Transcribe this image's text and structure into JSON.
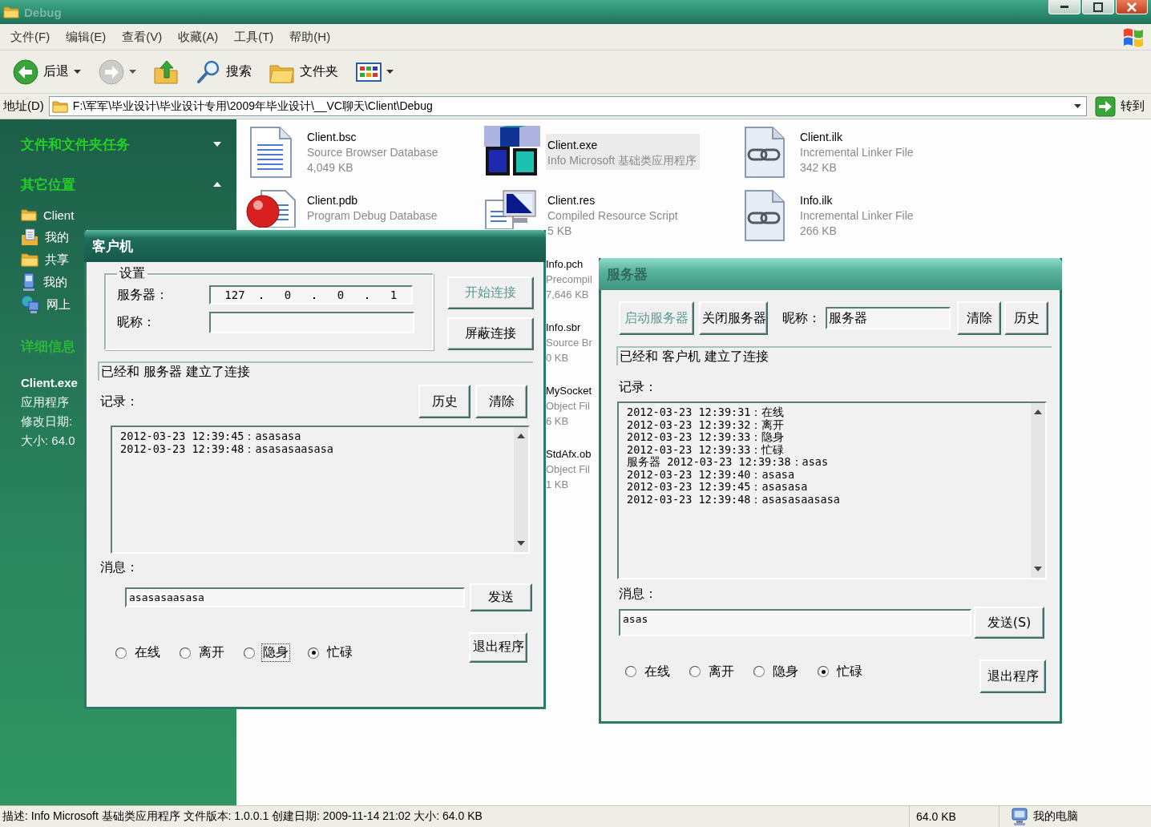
{
  "window": {
    "title": "Debug",
    "active": false
  },
  "menu": [
    "文件(F)",
    "编辑(E)",
    "查看(V)",
    "收藏(A)",
    "工具(T)",
    "帮助(H)"
  ],
  "toolbar": [
    {
      "kind": "back",
      "label": "后退",
      "disabled": false
    },
    {
      "kind": "forward",
      "disabled": true
    },
    {
      "kind": "up",
      "disabled": false
    },
    {
      "kind": "search",
      "label": "搜索",
      "disabled": false
    },
    {
      "kind": "folders",
      "label": "文件夹",
      "disabled": false
    },
    {
      "kind": "views",
      "disabled": false
    }
  ],
  "address": {
    "label": "地址(D)",
    "path": "F:\\军军\\毕业设计\\毕业设计专用\\2009年毕业设计\\__VC聊天\\Client\\Debug",
    "go": "转到"
  },
  "sidebar": {
    "sections": [
      {
        "title": "文件和文件夹任务",
        "expanded": false
      },
      {
        "title": "其它位置",
        "expanded": true,
        "items": [
          {
            "kind": "folder",
            "label": "Client"
          },
          {
            "kind": "documents",
            "label": "我的"
          },
          {
            "kind": "shared",
            "label": "共享"
          },
          {
            "kind": "computer",
            "label": "我的"
          },
          {
            "kind": "network",
            "label": "网上"
          }
        ]
      },
      {
        "title": "详细信息",
        "details": [
          {
            "kind": "name",
            "text": "Client.exe"
          },
          {
            "kind": "type",
            "text": "应用程序"
          },
          {
            "kind": "line",
            "text": "修改日期:"
          },
          {
            "kind": "line",
            "text": "大小: 64.0"
          }
        ]
      }
    ]
  },
  "files": [
    {
      "kind": "document",
      "name": "Client.bsc",
      "type": "Source Browser Database",
      "size": "4,049 KB",
      "selected": false
    },
    {
      "kind": "application",
      "name": "Client.exe",
      "type": "Info Microsoft 基础类应用程序",
      "selected": true
    },
    {
      "kind": "linker",
      "name": "Client.ilk",
      "type": "Incremental Linker File",
      "size": "342 KB",
      "selected": false
    },
    {
      "kind": "debug",
      "name": "Client.pdb",
      "type": "Program Debug Database",
      "selected": false
    },
    {
      "kind": "resource",
      "name": "Client.res",
      "type": "Compiled Resource Script",
      "size": "5 KB",
      "selected": false
    },
    {
      "kind": "linker",
      "name": "Info.ilk",
      "type": "Incremental Linker File",
      "size": "266 KB",
      "selected": false
    },
    {
      "kind": "covered",
      "name": "Info.pch",
      "type": "Precompil",
      "size": "7,646 KB",
      "selected": false
    },
    {
      "kind": "covered",
      "name": "Info.sbr",
      "type": "Source Br",
      "size": "0 KB",
      "selected": false
    },
    {
      "kind": "covered",
      "name": "MySocket",
      "type": "Object Fil",
      "size": "6 KB",
      "selected": false
    },
    {
      "kind": "covered",
      "name": "StdAfx.ob",
      "type": "Object Fil",
      "size": "1 KB",
      "selected": false
    }
  ],
  "status_bar": {
    "description": "描述: Info Microsoft 基础类应用程序 文件版本: 1.0.0.1 创建日期: 2009-11-14 21:02 大小: 64.0 KB",
    "size": "64.0 KB",
    "zone": "我的电脑"
  },
  "client_window": {
    "title": "客户机",
    "active": true,
    "settings_title": "设置",
    "server_label": "服务器：",
    "server_ip": [
      "127",
      "0",
      "0",
      "1"
    ],
    "nickname_label": "昵称：",
    "connect_buttons": [
      {
        "label": "开始连接",
        "disabled": true
      },
      {
        "label": "屏蔽连接",
        "disabled": false
      }
    ],
    "status": "已经和 服务器 建立了连接",
    "log_label": "记录：",
    "log_buttons": [
      {
        "label": "历史",
        "disabled": false
      },
      {
        "label": "清除",
        "disabled": false
      }
    ],
    "log": [
      "2012-03-23 12:39:45：asasasa",
      "2012-03-23 12:39:48：asasasaasasa"
    ],
    "message_label": "消息：",
    "message": "asasasaasasa",
    "send_button": "发送",
    "status_options": [
      {
        "label": "在线",
        "selected": false,
        "focused": false
      },
      {
        "label": "离开",
        "selected": false,
        "focused": false
      },
      {
        "label": "隐身",
        "selected": false,
        "focused": true
      },
      {
        "label": "忙碌",
        "selected": true,
        "focused": false
      }
    ],
    "exit_button": "退出程序"
  },
  "server_window": {
    "title": "服务器",
    "active": false,
    "server_buttons": [
      {
        "label": "启动服务器",
        "disabled": true
      },
      {
        "label": "关闭服务器",
        "disabled": false
      }
    ],
    "nickname_label": "昵称：",
    "nickname": "服务器",
    "log_buttons": [
      {
        "label": "清除",
        "disabled": false
      },
      {
        "label": "历史",
        "disabled": false
      }
    ],
    "status": "已经和 客户机 建立了连接",
    "log_label": "记录：",
    "log": [
      "2012-03-23 12:39:31：在线",
      "2012-03-23 12:39:32：离开",
      "2012-03-23 12:39:33：隐身",
      "2012-03-23 12:39:33：忙碌",
      "服务器 2012-03-23 12:39:38：asas",
      "2012-03-23 12:39:40：asasa",
      "2012-03-23 12:39:45：asasasa",
      "2012-03-23 12:39:48：asasasaasasa"
    ],
    "message_label": "消息：",
    "message": "asas",
    "send_button": "发送(S)",
    "status_options": [
      {
        "label": "在线",
        "selected": false,
        "focused": false
      },
      {
        "label": "离开",
        "selected": false,
        "focused": false
      },
      {
        "label": "隐身",
        "selected": false,
        "focused": false
      },
      {
        "label": "忙碌",
        "selected": true,
        "focused": false
      }
    ],
    "exit_button": "退出程序"
  }
}
